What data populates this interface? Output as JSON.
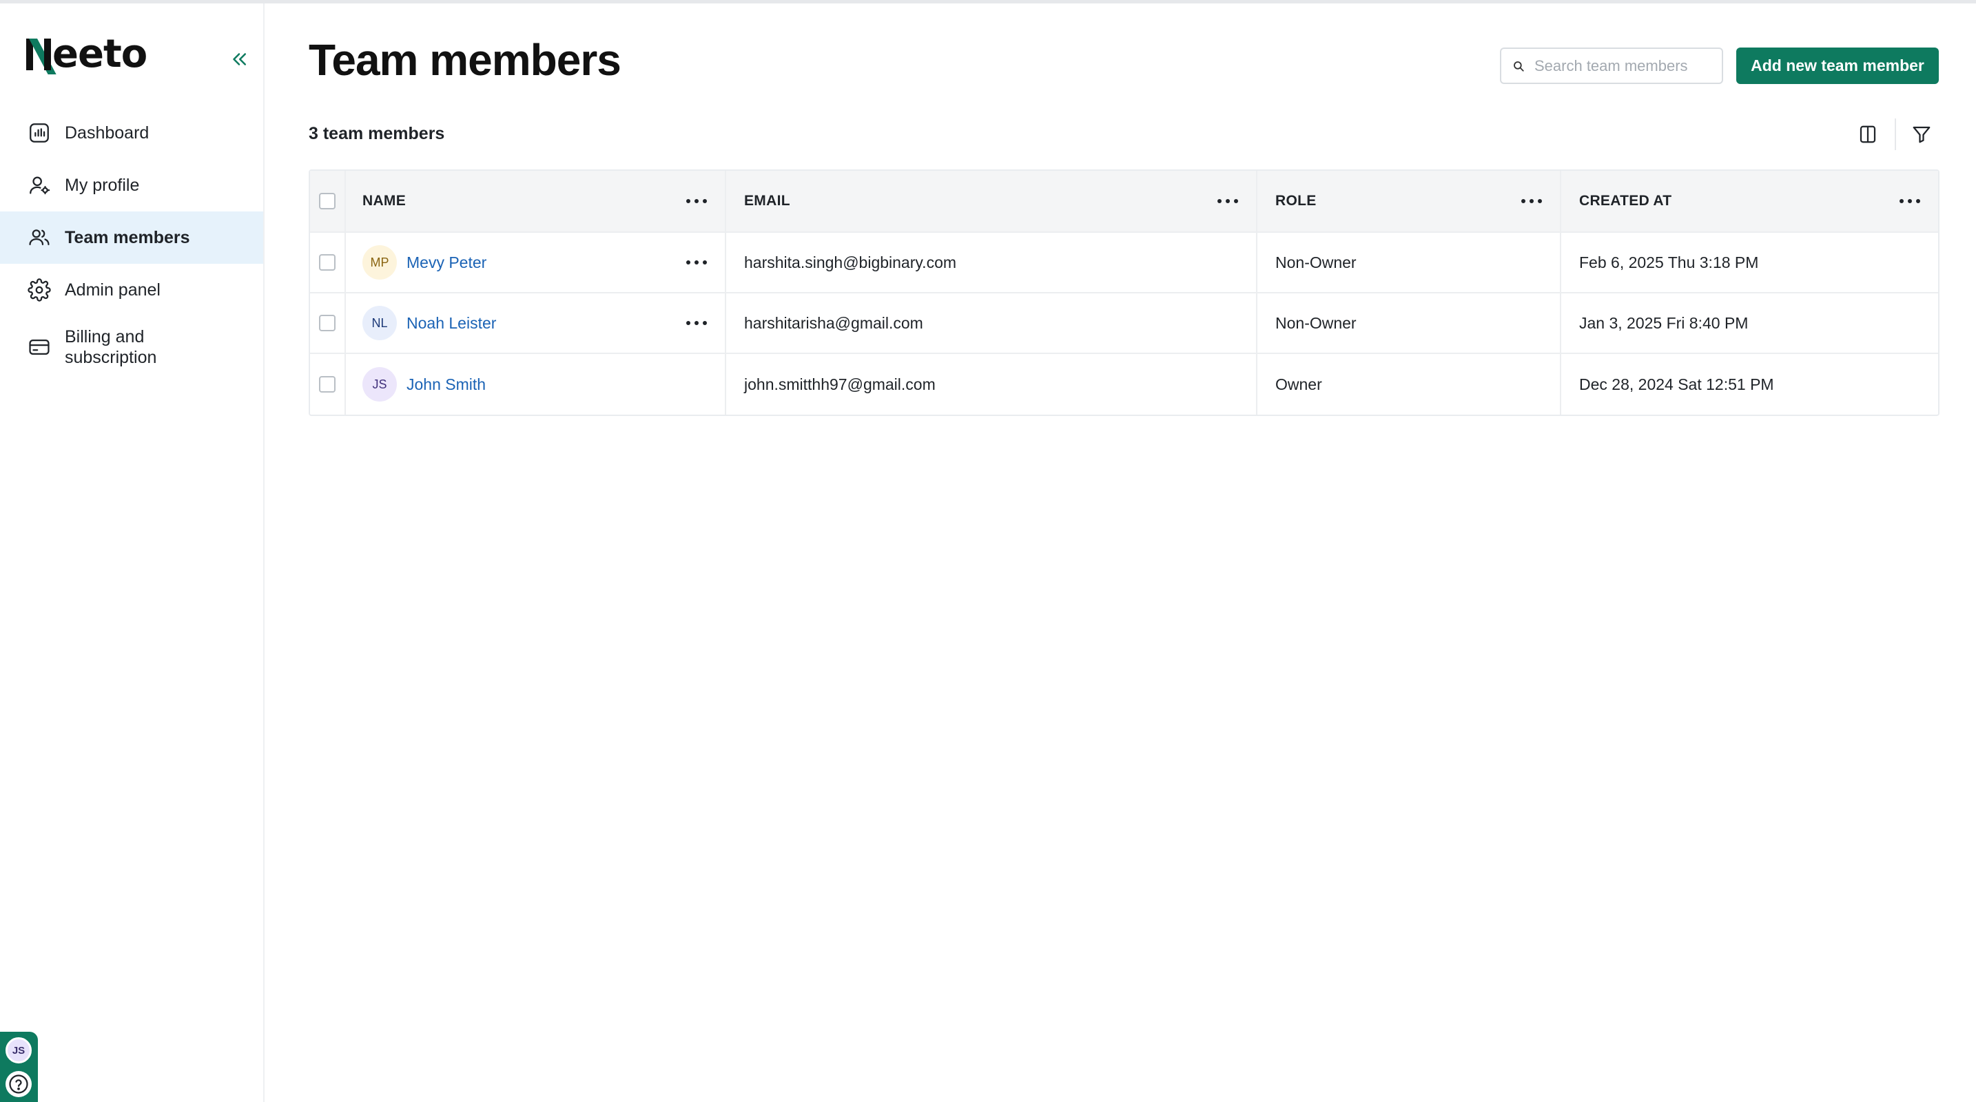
{
  "app": {
    "logo_text": "eeto"
  },
  "sidebar": {
    "items": [
      {
        "label": "Dashboard",
        "icon": "dashboard-icon",
        "active": false
      },
      {
        "label": "My profile",
        "icon": "user-settings-icon",
        "active": false
      },
      {
        "label": "Team members",
        "icon": "users-icon",
        "active": true
      },
      {
        "label": "Admin panel",
        "icon": "gear-icon",
        "active": false
      },
      {
        "label": "Billing and\nsubscription",
        "icon": "credit-card-icon",
        "active": false
      }
    ],
    "user_initials": "JS"
  },
  "header": {
    "title": "Team members",
    "search_placeholder": "Search team members",
    "add_button": "Add new team member"
  },
  "toolbar": {
    "count_label": "3 team members"
  },
  "table": {
    "columns": [
      "NAME",
      "EMAIL",
      "ROLE",
      "CREATED AT"
    ],
    "rows": [
      {
        "initials": "MP",
        "name": "Mevy Peter",
        "email": "harshita.singh@bigbinary.com",
        "role": "Non-Owner",
        "created_at": "Feb 6, 2025 Thu 3:18 PM"
      },
      {
        "initials": "NL",
        "name": "Noah Leister",
        "email": "harshitarisha@gmail.com",
        "role": "Non-Owner",
        "created_at": "Jan 3, 2025 Fri 8:40 PM"
      },
      {
        "initials": "JS",
        "name": "John Smith",
        "email": "john.smitthh97@gmail.com",
        "role": "Owner",
        "created_at": "Dec 28, 2024 Sat 12:51 PM"
      }
    ]
  },
  "colors": {
    "brand": "#0e7a5f",
    "link": "#1b63b5",
    "active_nav": "#e6f2fb"
  }
}
